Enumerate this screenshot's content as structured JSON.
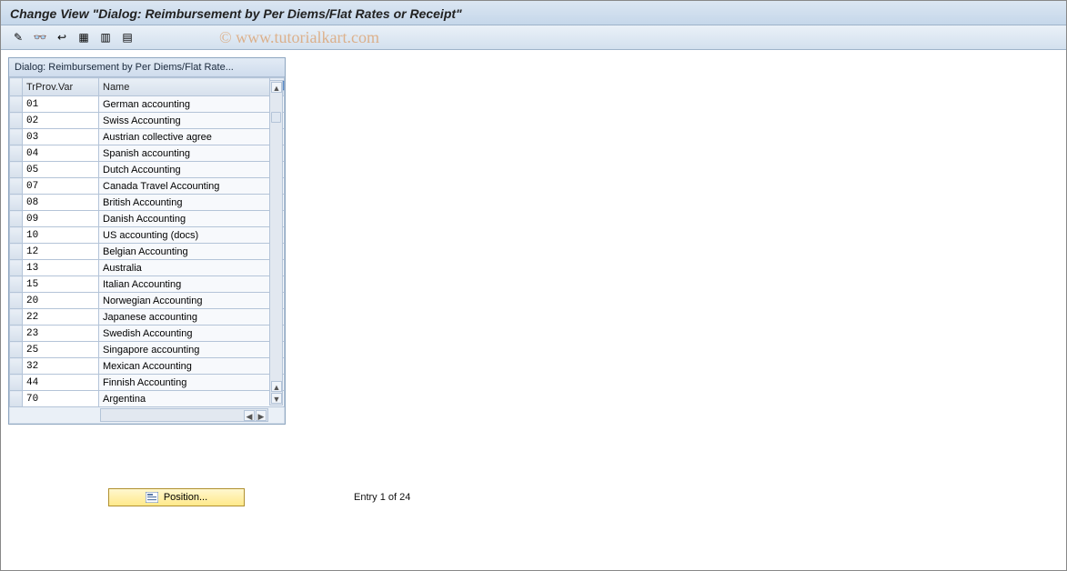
{
  "window": {
    "title": "Change View \"Dialog: Reimbursement by Per Diems/Flat Rates or Receipt\""
  },
  "watermark": "© www.tutorialkart.com",
  "toolbar": {
    "buttons": [
      {
        "name": "change-icon",
        "glyph": "✎"
      },
      {
        "name": "glasses-icon",
        "glyph": "👓"
      },
      {
        "name": "undo-icon",
        "glyph": "↩"
      },
      {
        "name": "select-all-icon",
        "glyph": "▦"
      },
      {
        "name": "select-block-icon",
        "glyph": "▥"
      },
      {
        "name": "deselect-all-icon",
        "glyph": "▤"
      }
    ]
  },
  "panel": {
    "title": "Dialog: Reimbursement by Per Diems/Flat Rate...",
    "columns": {
      "code": "TrProv.Var",
      "name": "Name"
    },
    "rows": [
      {
        "code": "01",
        "name": "German accounting"
      },
      {
        "code": "02",
        "name": "Swiss Accounting"
      },
      {
        "code": "03",
        "name": "Austrian collective agree"
      },
      {
        "code": "04",
        "name": "Spanish accounting"
      },
      {
        "code": "05",
        "name": "Dutch Accounting"
      },
      {
        "code": "07",
        "name": "Canada Travel Accounting"
      },
      {
        "code": "08",
        "name": "British Accounting"
      },
      {
        "code": "09",
        "name": "Danish Accounting"
      },
      {
        "code": "10",
        "name": "US accounting (docs)"
      },
      {
        "code": "12",
        "name": "Belgian Accounting"
      },
      {
        "code": "13",
        "name": "Australia"
      },
      {
        "code": "15",
        "name": "Italian Accounting"
      },
      {
        "code": "20",
        "name": "Norwegian Accounting"
      },
      {
        "code": "22",
        "name": "Japanese accounting"
      },
      {
        "code": "23",
        "name": "Swedish Accounting"
      },
      {
        "code": "25",
        "name": "Singapore accounting"
      },
      {
        "code": "32",
        "name": "Mexican Accounting"
      },
      {
        "code": "44",
        "name": "Finnish Accounting"
      },
      {
        "code": "70",
        "name": "Argentina"
      }
    ]
  },
  "footer": {
    "position_label": "Position...",
    "entry_label": "Entry 1 of 24"
  }
}
